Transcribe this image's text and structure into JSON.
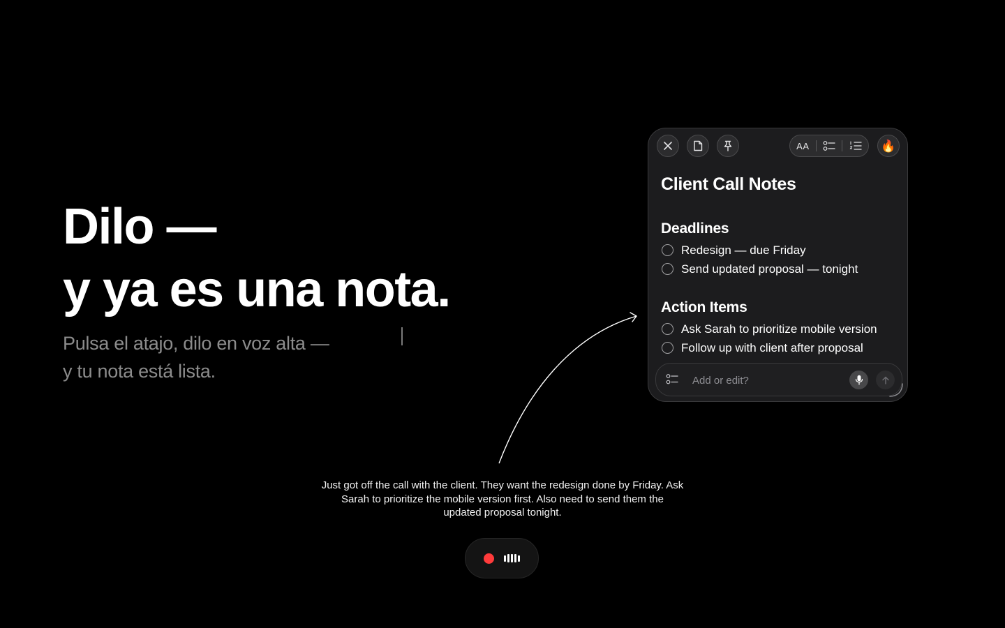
{
  "hero": {
    "title_line1": "Dilo —",
    "title_line2": "y ya es una nota.",
    "subtitle_line1": "Pulsa el atajo, dilo en voz alta —",
    "subtitle_line2": "y tu nota está lista."
  },
  "transcript": {
    "text": "Just got off the call with the client. They want the redesign done by Friday. Ask Sarah to prioritize the mobile version first. Also need to send them the updated proposal tonight."
  },
  "recorder": {
    "status": "recording",
    "dot_color": "#ff3b3b"
  },
  "note": {
    "toolbar": {
      "icons": [
        "close-icon",
        "note-icon",
        "pin-icon",
        "text-size-icon",
        "checklist-icon",
        "numbered-list-icon",
        "fire-icon"
      ],
      "text_size_label": "AA",
      "fire_emoji": "🔥"
    },
    "title": "Client Call Notes",
    "sections": [
      {
        "heading": "Deadlines",
        "tasks": [
          {
            "text": "Redesign — due Friday",
            "checked": false
          },
          {
            "text": "Send updated proposal — tonight",
            "checked": false
          }
        ]
      },
      {
        "heading": "Action Items",
        "tasks": [
          {
            "text": "Ask Sarah to prioritize mobile version",
            "checked": false
          },
          {
            "text": "Follow up with client after proposal",
            "checked": false
          }
        ]
      }
    ],
    "input": {
      "placeholder": "Add or edit?",
      "value": ""
    }
  },
  "colors": {
    "background": "#000000",
    "card": "#1c1c1e",
    "muted_text": "#8c8c8c",
    "record": "#ff3b3b"
  }
}
